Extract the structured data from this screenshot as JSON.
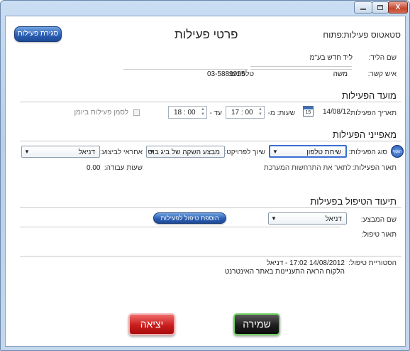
{
  "window": {
    "minimize": "—",
    "maximize": "□",
    "close": "X"
  },
  "header": {
    "title": "פרטי פעילות",
    "close_activity_button": "סגירת פעילות",
    "status_label": "סטאטוס פעילות:",
    "status_value": "פתוח"
  },
  "lead": {
    "name_label": "שם הליד:",
    "name_value": "ליד חדש בע\"מ",
    "contact_label": "איש קשר:",
    "contact_value": "משה",
    "phone_label": "טלפונים:",
    "phone_value": "03-5889955"
  },
  "timing": {
    "section_title": "מועד הפעילות",
    "date_label": "תאריך הפעילות:",
    "date_value": "14/08/12",
    "calendar_day": "15",
    "hours_from_label": "שעות: מ-",
    "from_hour": "17",
    "from_min": "00",
    "to_label": "עד -",
    "to_hour": "18",
    "to_min": "00",
    "schedule_checkbox_label": "לסמן פעילות ביומן"
  },
  "characteristics": {
    "section_title": "מאפייני הפעילות",
    "type_label": "סוג הפעילות:",
    "type_value": "שיחת טלפון",
    "type_button": "הוסף",
    "project_label": "שיוך לפרויקט:",
    "project_value": "מבצע השקה של ביג בוס",
    "responsible_label": "אחראי לביצוע:",
    "responsible_value": "דניאל",
    "description_label": "תאור הפעילות:",
    "description_value": "לתאר את התרחשות המערכת",
    "work_hours_label": "שעות עבודה:",
    "work_hours_value": "0.00"
  },
  "handling": {
    "section_title": "תיעוד הטיפול בפעילות",
    "executor_label": "שם המבצע:",
    "executor_value": "דניאל",
    "add_handling_button": "הוספת טיפול לפעילות",
    "description_label": "תאור טיפול:",
    "history_label": "הסטוריית טיפול:",
    "history_line1": "14/08/2012 17:02 - דניאל",
    "history_line2": "הלקוח הראה התעניינות באתר האינטרנט"
  },
  "footer": {
    "save_button": "שמירה",
    "exit_button": "יציאה"
  }
}
